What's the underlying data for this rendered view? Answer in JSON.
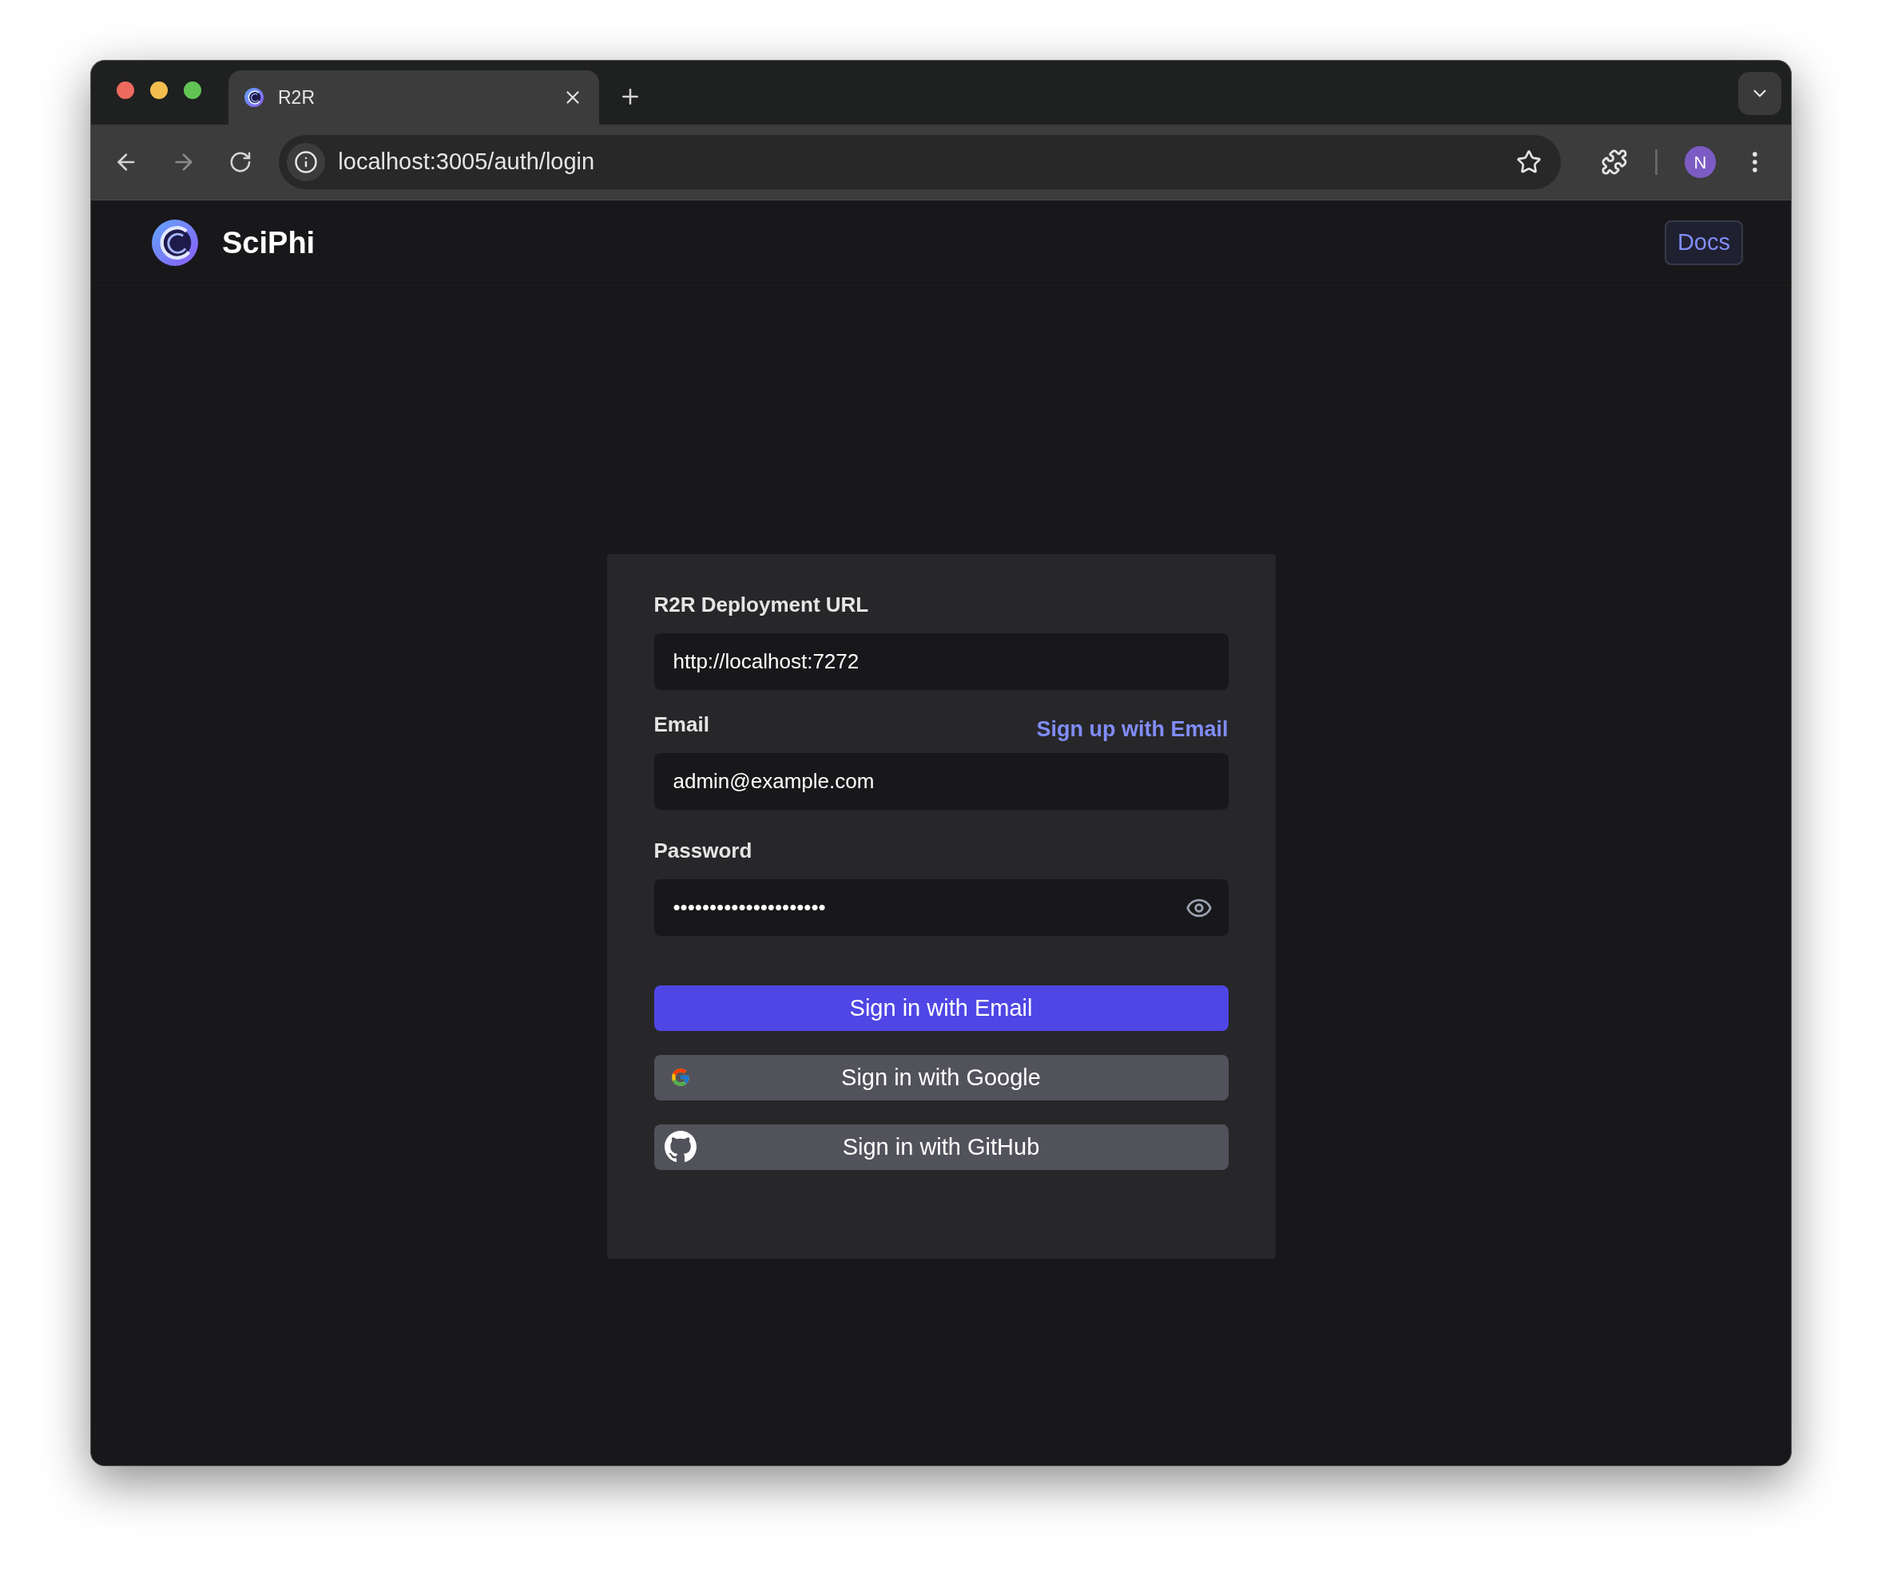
{
  "browser": {
    "tab": {
      "title": "R2R",
      "selected": true
    },
    "url": "localhost:3005/auth/login",
    "avatar": "N"
  },
  "header": {
    "brand": "SciPhi",
    "docs": "Docs"
  },
  "form": {
    "url_label": "R2R Deployment URL",
    "url_value": "http://localhost:7272",
    "email_label": "Email",
    "signup_link": "Sign up with Email",
    "email_value": "admin@example.com",
    "password_label": "Password",
    "password_value": "•••••••••••••••••••••",
    "buttons": [
      {
        "label": "Sign in with Email",
        "kind": "primary"
      },
      {
        "label": "Sign in with Google",
        "kind": "google"
      },
      {
        "label": "Sign in with GitHub",
        "kind": "github"
      }
    ]
  }
}
